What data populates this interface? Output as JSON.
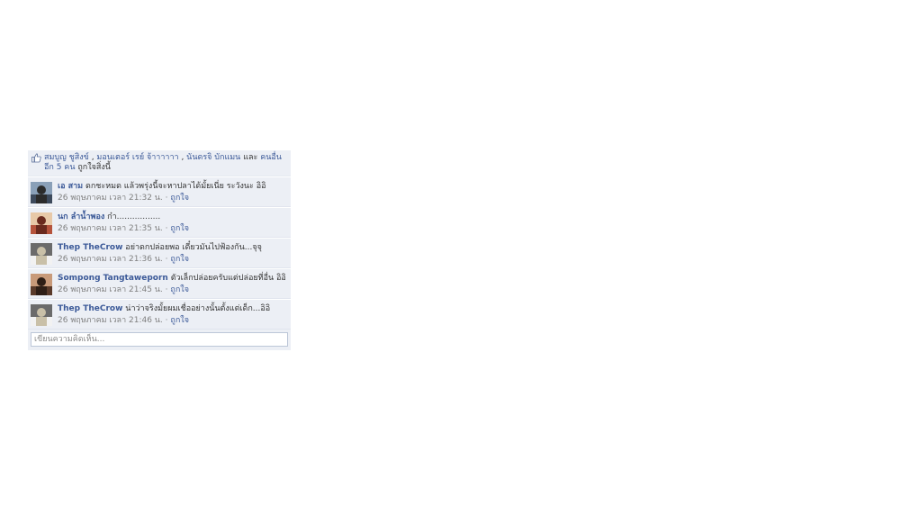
{
  "likes": {
    "names": [
      "สมบูญ ชูสิงข์",
      "มอนเตอร์ เรย์ จ้าาาาาา",
      "นันดรจิ บักแมน"
    ],
    "sep1": " , ",
    "sep2": " , ",
    "and": " และ ",
    "others": "คนอื่นอีก 5 คน",
    "suffix": " ถูกใจสิ่งนี้",
    "icon": "thumbs-up-icon"
  },
  "comments": [
    {
      "author": "เอ สาม",
      "text": "ดกชะหมด แล้วพรุ่งนี้จะหาปลาได้มั้ยเนี่ย ระวังนะ อิอิ",
      "time": "26 พฤษภาคม เวลา 21:32 น.",
      "dot": " · ",
      "like": "ถูกใจ",
      "avatar_colors": [
        "#3d4a5c",
        "#8aa0b8",
        "#2b2b2b"
      ]
    },
    {
      "author": "นก ลำน้ำพอง",
      "text": "ก๋า.................",
      "time": "26 พฤษภาคม เวลา 21:35 น.",
      "dot": " · ",
      "like": "ถูกใจ",
      "avatar_colors": [
        "#b5533c",
        "#e8c9a8",
        "#6a2a1e"
      ]
    },
    {
      "author": "Thep TheCrow",
      "text": "อย่าดกปล่อยพอ เดี๋ยวมันไปฟ้องกัน...จุจุ",
      "time": "26 พฤษภาคม เวลา 21:36 น.",
      "dot": " · ",
      "like": "ถูกใจ",
      "avatar_colors": [
        "#f2f2f2",
        "#6b6b6b",
        "#c9c0a8"
      ]
    },
    {
      "author": "Sompong Tangtaweporn",
      "text": "ตัวเล็กปล่อยครับแต่ปล่อยที่อื่น อิอิ",
      "time": "26 พฤษภาคม เวลา 21:45 น.",
      "dot": " · ",
      "like": "ถูกใจ",
      "avatar_colors": [
        "#5a3a2a",
        "#c89a7a",
        "#2e1e16"
      ]
    },
    {
      "author": "Thep TheCrow",
      "text": "น่าว่าจริงมั้ยผมเชื่ออย่างนั้นตั้งแต่เด็ก...อิอิ",
      "time": "26 พฤษภาคม เวลา 21:46 น.",
      "dot": " · ",
      "like": "ถูกใจ",
      "avatar_colors": [
        "#f2f2f2",
        "#6b6b6b",
        "#c9c0a8"
      ]
    }
  ],
  "write_comment": {
    "placeholder": "เขียนความคิดเห็น..."
  }
}
